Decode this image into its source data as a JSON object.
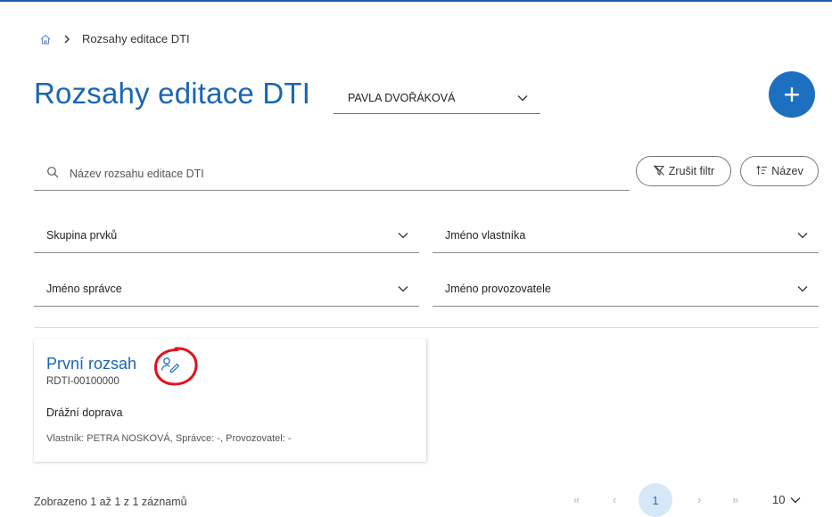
{
  "breadcrumb": {
    "current": "Rozsahy editace DTI"
  },
  "header": {
    "title": "Rozsahy editace DTI",
    "user_select": "PAVLA DVOŘÁKOVÁ",
    "add_button": "+"
  },
  "search": {
    "placeholder": "Název rozsahu editace DTI"
  },
  "actions": {
    "clear_filter": "Zrušit filtr",
    "sort": "Název"
  },
  "filters": {
    "group": "Skupina prvků",
    "owner": "Jméno vlastníka",
    "admin": "Jméno správce",
    "operator": "Jméno provozovatele"
  },
  "items": [
    {
      "title": "První rozsah",
      "id": "RDTI-00100000",
      "type": "Drážní doprava",
      "meta": "Vlastník: PETRA NOSKOVÁ, Správce: -, Provozovatel: -"
    }
  ],
  "footer": {
    "summary": "Zobrazeno 1 až 1 z 1 záznamů",
    "first": "«",
    "prev": "‹",
    "current_page": "1",
    "next": "›",
    "last": "»",
    "page_size": "10"
  },
  "colors": {
    "accent": "#1d6fc0",
    "title": "#1a66b3",
    "annotation": "#e0141e"
  },
  "icons": [
    "home-icon",
    "chevron-right-icon",
    "chevron-down-icon",
    "search-icon",
    "filter-off-icon",
    "sort-icon",
    "user-edit-icon"
  ]
}
